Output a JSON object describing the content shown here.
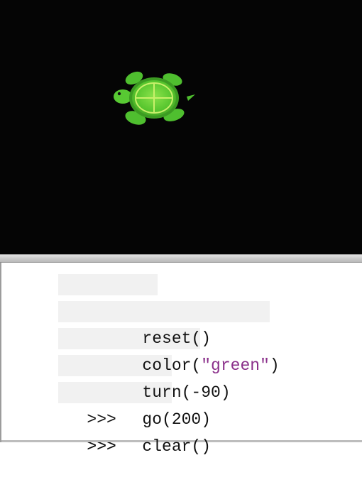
{
  "canvas": {
    "background": "#050505",
    "turtle": {
      "icon": "turtle-icon",
      "color": "#5fd23a"
    }
  },
  "console": {
    "prompt": ">>>",
    "lines": [
      {
        "prompt": ">>>",
        "code_prefix": "reset()",
        "string": "",
        "code_suffix": ""
      },
      {
        "prompt": ">>>",
        "code_prefix": "color(",
        "string": "\"green\"",
        "code_suffix": ")"
      },
      {
        "prompt": ">>>",
        "code_prefix": "turn(-90)",
        "string": "",
        "code_suffix": ""
      },
      {
        "prompt": ">>>",
        "code_prefix": "go(200)",
        "string": "",
        "code_suffix": ""
      },
      {
        "prompt": ">>>",
        "code_prefix": "clear()",
        "string": "",
        "code_suffix": ""
      },
      {
        "prompt": ">>>",
        "code_prefix": "",
        "string": "",
        "code_suffix": ""
      }
    ]
  },
  "colors": {
    "string_literal": "#8a2f8a",
    "text": "#111111"
  }
}
